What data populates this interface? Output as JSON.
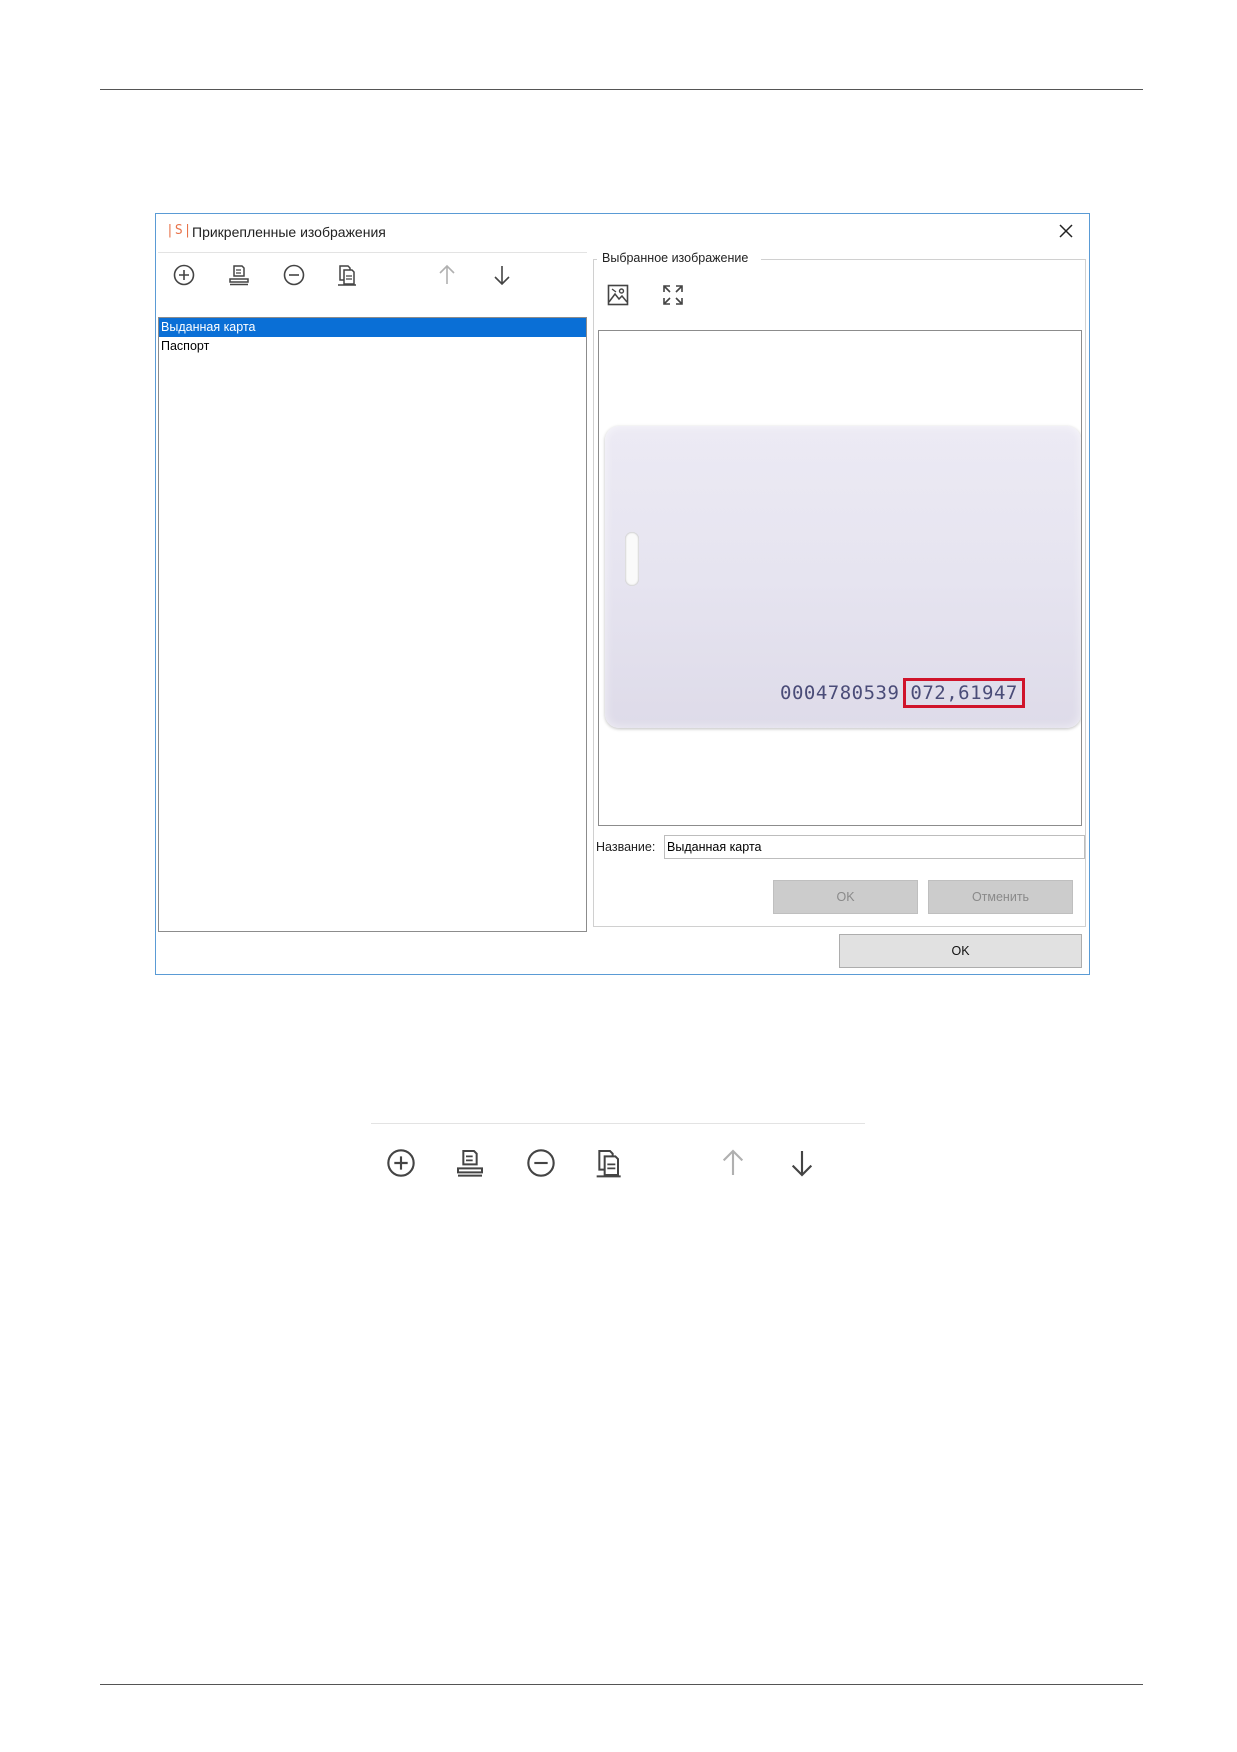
{
  "dialog": {
    "logo": "|S|",
    "title": "Прикрепленные изображения",
    "close_icon": "close-icon"
  },
  "toolbar": {
    "icons": [
      "add-circle-icon",
      "scan-icon",
      "remove-circle-icon",
      "copy-pages-icon",
      "arrow-up-icon",
      "arrow-down-icon"
    ]
  },
  "list": {
    "items": [
      {
        "label": "Выданная карта",
        "selected": true
      },
      {
        "label": "Паспорт",
        "selected": false
      }
    ]
  },
  "selected_image": {
    "group_title": "Выбранное изображение",
    "icons": [
      "image-icon",
      "fullscreen-icon"
    ],
    "card_number": "0004780539",
    "card_code": "072,61947",
    "highlight_color": "#d0142b"
  },
  "form": {
    "name_label": "Название:",
    "name_value": "Выданная карта",
    "ok_label": "OK",
    "cancel_label": "Отменить"
  },
  "footer": {
    "ok_label": "OK"
  },
  "colors": {
    "selection": "#0a6fd6",
    "border_accent": "#5a9bd5",
    "logo": "#e8734a"
  }
}
